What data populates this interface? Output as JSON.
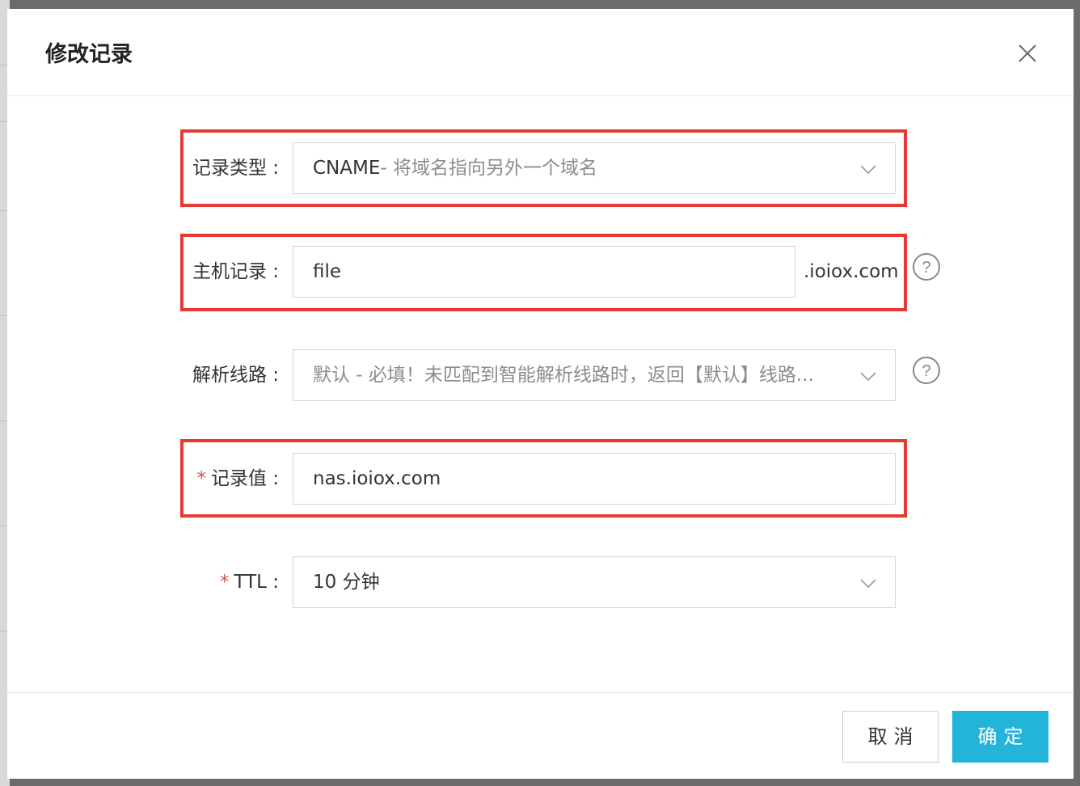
{
  "dialog": {
    "title": "修改记录",
    "close_icon": "close-icon"
  },
  "form": {
    "record_type": {
      "label": "记录类型 :",
      "value_prefix": "CNAME",
      "value_rest": "- 将域名指向另外一个域名"
    },
    "host_record": {
      "label": "主机记录 :",
      "value": "file",
      "suffix": ".ioiox.com",
      "help_icon": "question-circle-icon"
    },
    "resolve_line": {
      "label": "解析线路 :",
      "value": "默认 - 必填！未匹配到智能解析线路时，返回【默认】线路...",
      "help_icon": "question-circle-icon"
    },
    "record_value": {
      "required_mark": "*",
      "label": "记录值 :",
      "value": "nas.ioiox.com"
    },
    "ttl": {
      "required_mark": "*",
      "label": "TTL :",
      "value": "10 分钟"
    }
  },
  "footer": {
    "cancel_label": "取消",
    "ok_label": "确定"
  },
  "colors": {
    "highlight": "#e53935",
    "primary": "#22b5d9",
    "required": "#d9534f"
  }
}
